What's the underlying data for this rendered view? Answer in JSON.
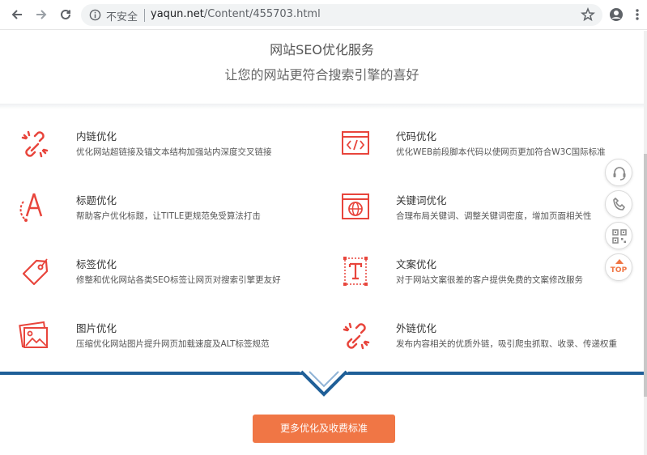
{
  "browser": {
    "insecure_label": "不安全",
    "url_host": "yaqun.net",
    "url_path": "/Content/455703.html"
  },
  "hero": {
    "title": "网站SEO优化服务",
    "subtitle": "让您的网站更符合搜索引擎的喜好"
  },
  "features": [
    {
      "title": "内链优化",
      "desc": "优化网站超链接及锚文本结构加强站内深度交叉链接",
      "icon": "broken-link-icon"
    },
    {
      "title": "代码优化",
      "desc": "优化WEB前段脚本代码以使网页更加符合W3C国际标准",
      "icon": "code-window-icon"
    },
    {
      "title": "标题优化",
      "desc": "帮助客户优化标题，让TITLE更规范免受算法打击",
      "icon": "letter-a-icon"
    },
    {
      "title": "关键词优化",
      "desc": "合理布局关键词、调整关键词密度，增加页面相关性",
      "icon": "globe-window-icon"
    },
    {
      "title": "标签优化",
      "desc": "修整和优化网站各类SEO标签让网页对搜索引擎更友好",
      "icon": "tag-icon"
    },
    {
      "title": "文案优化",
      "desc": "对于网站文案很差的客户提供免费的文案修改服务",
      "icon": "text-t-icon"
    },
    {
      "title": "图片优化",
      "desc": "压缩优化网站图片提升网页加载速度及ALT标签规范",
      "icon": "image-icon"
    },
    {
      "title": "外链优化",
      "desc": "发布内容相关的优质外链，吸引爬虫抓取、收录、传递权重",
      "icon": "broken-link-icon"
    }
  ],
  "cta": {
    "label": "更多优化及收费标准"
  },
  "side": {
    "top_label": "TOP"
  },
  "colors": {
    "accent": "#e8453c",
    "brand_blue": "#1f5f98",
    "cta": "#f07645"
  }
}
